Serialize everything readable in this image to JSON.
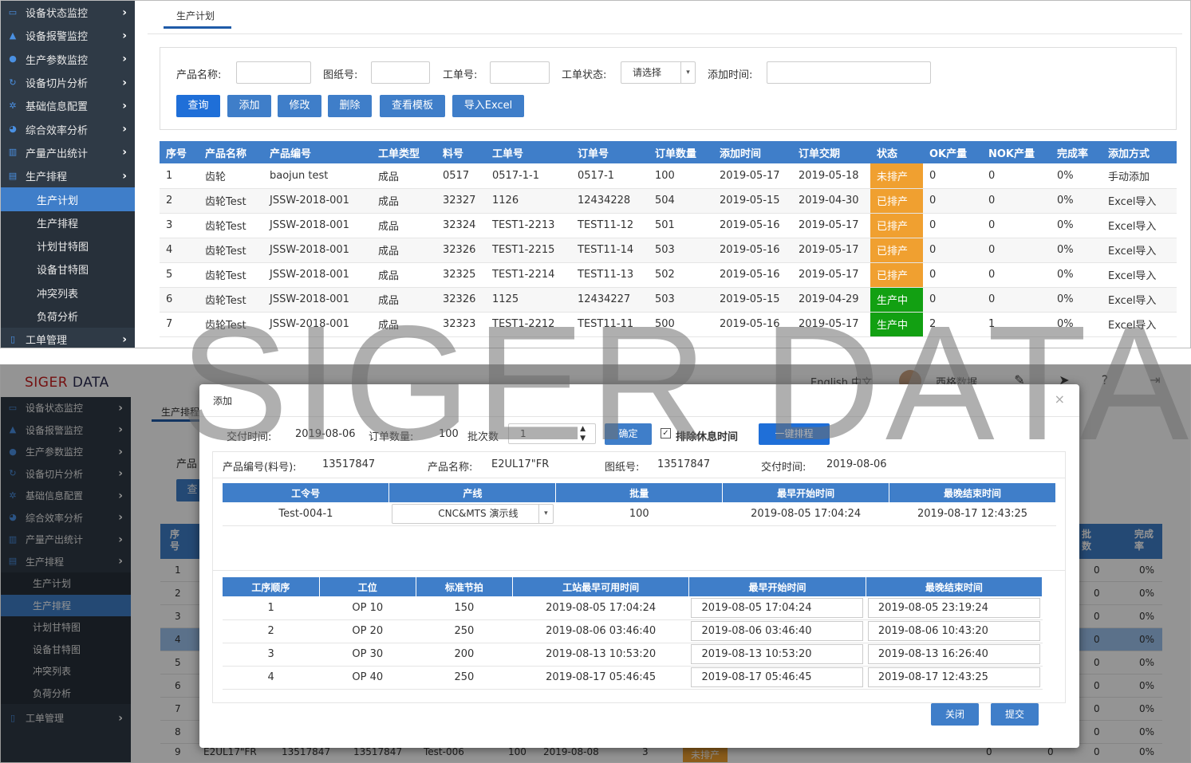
{
  "top": {
    "sidebar": {
      "items": [
        {
          "label": "设备状态监控"
        },
        {
          "label": "设备报警监控"
        },
        {
          "label": "生产参数监控"
        },
        {
          "label": "设备切片分析"
        },
        {
          "label": "基础信息配置"
        },
        {
          "label": "综合效率分析"
        },
        {
          "label": "产量产出统计"
        },
        {
          "label": "生产排程"
        }
      ],
      "subitems": [
        {
          "label": "生产计划"
        },
        {
          "label": "生产排程"
        },
        {
          "label": "计划甘特图"
        },
        {
          "label": "设备甘特图"
        },
        {
          "label": "冲突列表"
        },
        {
          "label": "负荷分析"
        }
      ],
      "last_item": "工单管理"
    },
    "tab": "生产计划",
    "search": {
      "product_name_label": "产品名称:",
      "drawing_no_label": "图纸号:",
      "work_order_label": "工单号:",
      "status_label": "工单状态:",
      "status_value": "请选择",
      "add_time_label": "添加时间:"
    },
    "buttons": {
      "query": "查询",
      "add": "添加",
      "edit": "修改",
      "delete": "删除",
      "template": "查看模板",
      "import": "导入Excel"
    },
    "table": {
      "headers": [
        "序号",
        "产品名称",
        "产品编号",
        "工单类型",
        "料号",
        "工单号",
        "订单号",
        "订单数量",
        "添加时间",
        "订单交期",
        "状态",
        "OK产量",
        "NOK产量",
        "完成率",
        "添加方式"
      ],
      "rows": [
        [
          "1",
          "齿轮",
          "baojun test",
          "成品",
          "0517",
          "0517-1-1",
          "0517-1",
          "100",
          "2019-05-17",
          "2019-05-18",
          "未排产",
          "0",
          "0",
          "0%",
          "手动添加"
        ],
        [
          "2",
          "齿轮Test",
          "JSSW-2018-001",
          "成品",
          "32327",
          "1126",
          "12434228",
          "504",
          "2019-05-15",
          "2019-04-30",
          "已排产",
          "0",
          "0",
          "0%",
          "Excel导入"
        ],
        [
          "3",
          "齿轮Test",
          "JSSW-2018-001",
          "成品",
          "32324",
          "TEST1-2213",
          "TEST11-12",
          "501",
          "2019-05-16",
          "2019-05-17",
          "已排产",
          "0",
          "0",
          "0%",
          "Excel导入"
        ],
        [
          "4",
          "齿轮Test",
          "JSSW-2018-001",
          "成品",
          "32326",
          "TEST1-2215",
          "TEST11-14",
          "503",
          "2019-05-16",
          "2019-05-17",
          "已排产",
          "0",
          "0",
          "0%",
          "Excel导入"
        ],
        [
          "5",
          "齿轮Test",
          "JSSW-2018-001",
          "成品",
          "32325",
          "TEST1-2214",
          "TEST11-13",
          "502",
          "2019-05-16",
          "2019-05-17",
          "已排产",
          "0",
          "0",
          "0%",
          "Excel导入"
        ],
        [
          "6",
          "齿轮Test",
          "JSSW-2018-001",
          "成品",
          "32326",
          "1125",
          "12434227",
          "503",
          "2019-05-15",
          "2019-04-29",
          "生产中",
          "0",
          "0",
          "0%",
          "Excel导入"
        ],
        [
          "7",
          "齿轮Test",
          "JSSW-2018-001",
          "成品",
          "32323",
          "TEST1-2212",
          "TEST11-11",
          "500",
          "2019-05-16",
          "2019-05-17",
          "生产中",
          "2",
          "1",
          "0%",
          "Excel导入"
        ]
      ]
    }
  },
  "bottom": {
    "logo_red": "SIGER",
    "logo_rest": " DATA",
    "header": {
      "lang": "English 中文",
      "user": "西格数据"
    },
    "sidebar": {
      "items": [
        {
          "label": "设备状态监控"
        },
        {
          "label": "设备报警监控"
        },
        {
          "label": "生产参数监控"
        },
        {
          "label": "设备切片分析"
        },
        {
          "label": "基础信息配置"
        },
        {
          "label": "综合效率分析"
        },
        {
          "label": "产量产出统计"
        },
        {
          "label": "生产排程"
        }
      ],
      "subitems": [
        {
          "label": "生产计划"
        },
        {
          "label": "生产排程"
        },
        {
          "label": "计划甘特图"
        },
        {
          "label": "设备甘特图"
        },
        {
          "label": "冲突列表"
        },
        {
          "label": "负荷分析"
        }
      ],
      "last_item": "工单管理"
    },
    "bg": {
      "tab": "生产排程",
      "label_product": "产品",
      "btn_query": "查",
      "col_seq": "序号",
      "col_batch": "批数",
      "col_rate": "完成率",
      "row_nums": [
        "1",
        "2",
        "3",
        "4",
        "5",
        "6",
        "7",
        "8"
      ],
      "zero": "0",
      "pct": "0%",
      "last_row": [
        "9",
        "E2UL17\"FR",
        "13517847",
        "13517847",
        "Test-006",
        "100",
        "2019-08-08",
        "3",
        "未排产",
        "0",
        "0",
        "0",
        "0%"
      ]
    }
  },
  "modal": {
    "title": "添加",
    "delivery_label": "交付时间:",
    "delivery_value": "2019-08-06",
    "qty_label": "订单数量:",
    "qty_value": "100",
    "batch_label": "批次数",
    "batch_value": "1",
    "confirm": "确定",
    "exclude_rest": "排除休息时间",
    "one_click": "一键排程",
    "info": {
      "product_no_label": "产品编号(料号):",
      "product_no": "13517847",
      "product_name_label": "产品名称:",
      "product_name": "E2UL17\"FR",
      "drawing_label": "图纸号:",
      "drawing": "13517847",
      "delivery_label": "交付时间:",
      "delivery": "2019-08-06"
    },
    "order_table": {
      "headers": [
        "工令号",
        "产线",
        "批量",
        "最早开始时间",
        "最晚结束时间"
      ],
      "row": {
        "order": "Test-004-1",
        "line": "CNC&MTS 演示线",
        "batch": "100",
        "start": "2019-08-05 17:04:24",
        "end": "2019-08-17 12:43:25"
      }
    },
    "op_table": {
      "headers": [
        "工序顺序",
        "工位",
        "标准节拍",
        "工站最早可用时间",
        "最早开始时间",
        "最晚结束时间"
      ],
      "rows": [
        [
          "1",
          "OP 10",
          "150",
          "2019-08-05 17:04:24",
          "2019-08-05 17:04:24",
          "2019-08-05 23:19:24"
        ],
        [
          "2",
          "OP 20",
          "250",
          "2019-08-06 03:46:40",
          "2019-08-06 03:46:40",
          "2019-08-06 10:43:20"
        ],
        [
          "3",
          "OP 30",
          "200",
          "2019-08-13 10:53:20",
          "2019-08-13 10:53:20",
          "2019-08-13 16:26:40"
        ],
        [
          "4",
          "OP 40",
          "250",
          "2019-08-17 05:46:45",
          "2019-08-17 05:46:45",
          "2019-08-17 12:43:25"
        ]
      ]
    },
    "close": "关闭",
    "submit": "提交"
  },
  "watermark": "SIGER DATA",
  "colors": {
    "accent": "#3f7ec9",
    "sidebar": "#2f3a46",
    "orange": "#f0a030",
    "green": "#12a012",
    "blue": "#1830c8"
  }
}
